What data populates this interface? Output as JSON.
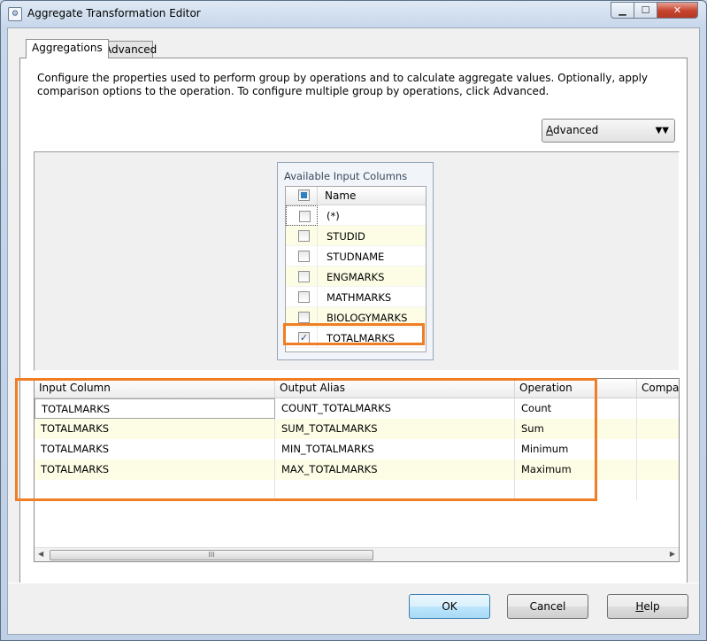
{
  "window": {
    "title": "Aggregate Transformation Editor",
    "icon": "ssis-component-icon",
    "controls": [
      "minimize",
      "maximize",
      "close"
    ]
  },
  "tabs": [
    {
      "label": "Aggregations",
      "selected": true
    },
    {
      "label": "Advanced",
      "selected": false
    }
  ],
  "aggregations_page": {
    "description": "Configure the properties used to perform group by operations and to calculate aggregate values. Optionally, apply comparison options to the operation. To configure multiple group by operations, click Advanced.",
    "advanced_toggle": {
      "label_prefix": "",
      "label_access_key": "A",
      "label_rest": "dvanced",
      "chevron": "▼▼"
    }
  },
  "available_columns": {
    "title": "Available Input Columns",
    "header": "Name",
    "columns": [
      {
        "name": "(*)",
        "checked": false
      },
      {
        "name": "STUDID",
        "checked": false
      },
      {
        "name": "STUDNAME",
        "checked": false
      },
      {
        "name": "ENGMARKS",
        "checked": false
      },
      {
        "name": "MATHMARKS",
        "checked": false
      },
      {
        "name": "BIOLOGYMARKS",
        "checked": false
      },
      {
        "name": "TOTALMARKS",
        "checked": true
      }
    ]
  },
  "aggregation_grid": {
    "headers": [
      "Input Column",
      "Output Alias",
      "Operation",
      "Compar"
    ],
    "rows": [
      {
        "input_column": "TOTALMARKS",
        "output_alias": "COUNT_TOTALMARKS",
        "operation": "Count"
      },
      {
        "input_column": "TOTALMARKS",
        "output_alias": "SUM_TOTALMARKS",
        "operation": "Sum"
      },
      {
        "input_column": "TOTALMARKS",
        "output_alias": "MIN_TOTALMARKS",
        "operation": "Minimum"
      },
      {
        "input_column": "TOTALMARKS",
        "output_alias": "MAX_TOTALMARKS",
        "operation": "Maximum"
      }
    ],
    "scroll_grip": "III"
  },
  "buttons": {
    "ok": "OK",
    "cancel": "Cancel",
    "help_access_key": "H",
    "help_rest": "elp"
  },
  "colors": {
    "highlight": "#f07e26",
    "alt_row": "#fdfde6",
    "check_accent": "#2f7fc3"
  }
}
